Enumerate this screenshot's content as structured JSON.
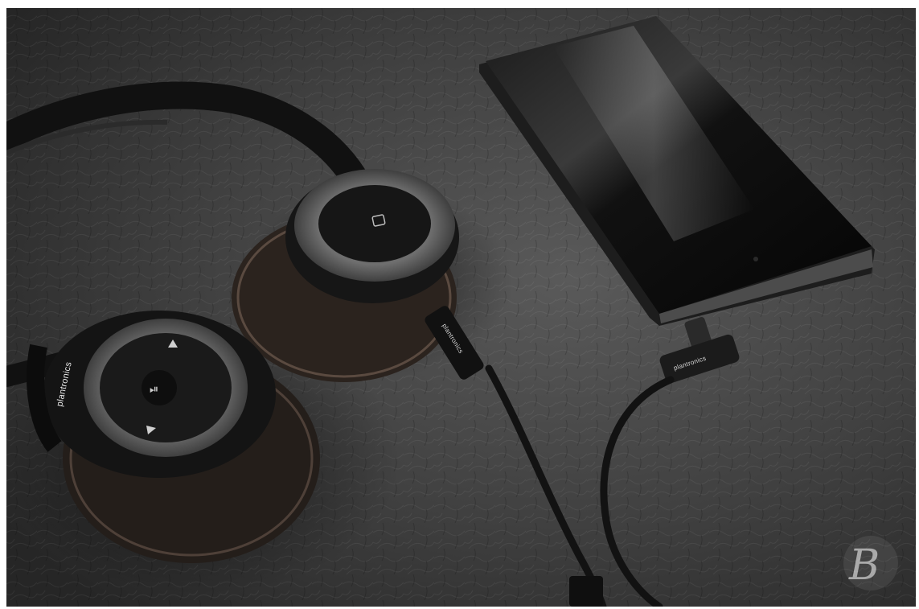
{
  "scene": {
    "subject": "headphones-and-smartphone",
    "surface_color": "#3b3b3b",
    "headphone_color": "#1c1c1c",
    "cushion_color": "#4a3b33",
    "phone_color": "#151515"
  },
  "headphones": {
    "cup_brand_label": "plantronics",
    "cable_brand_label": "plantronics"
  },
  "phone_plug": {
    "brand_label": "plantronics"
  },
  "watermark": {
    "glyph": "B"
  }
}
